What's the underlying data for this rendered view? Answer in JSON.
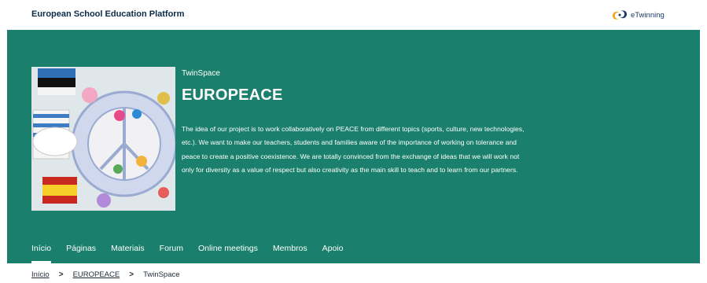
{
  "header": {
    "platform_title": "European School Education Platform",
    "brand_name": "eTwinning"
  },
  "hero": {
    "label": "TwinSpace",
    "title": "EUROPEACE",
    "description": "The idea of our project is to work collaboratively on PEACE from different topics (sports, culture, new technologies, etc.). We want to make our teachers, students and families aware of the importance of working on tolerance and peace to create a positive coexistence. We are totally convinced from the exchange of ideas that we will work not only for diversity as a value of respect but also creativity as the main skill to teach and to learn from our partners.",
    "background_color": "#1a7f6c"
  },
  "nav": {
    "tabs": [
      {
        "label": "Início",
        "active": true
      },
      {
        "label": "Páginas",
        "active": false
      },
      {
        "label": "Materiais",
        "active": false
      },
      {
        "label": "Forum",
        "active": false
      },
      {
        "label": "Online meetings",
        "active": false
      },
      {
        "label": "Membros",
        "active": false
      },
      {
        "label": "Apoio",
        "active": false
      }
    ]
  },
  "breadcrumb": {
    "items": [
      "Início",
      "EUROPEACE",
      "TwinSpace"
    ],
    "separator": ">"
  }
}
